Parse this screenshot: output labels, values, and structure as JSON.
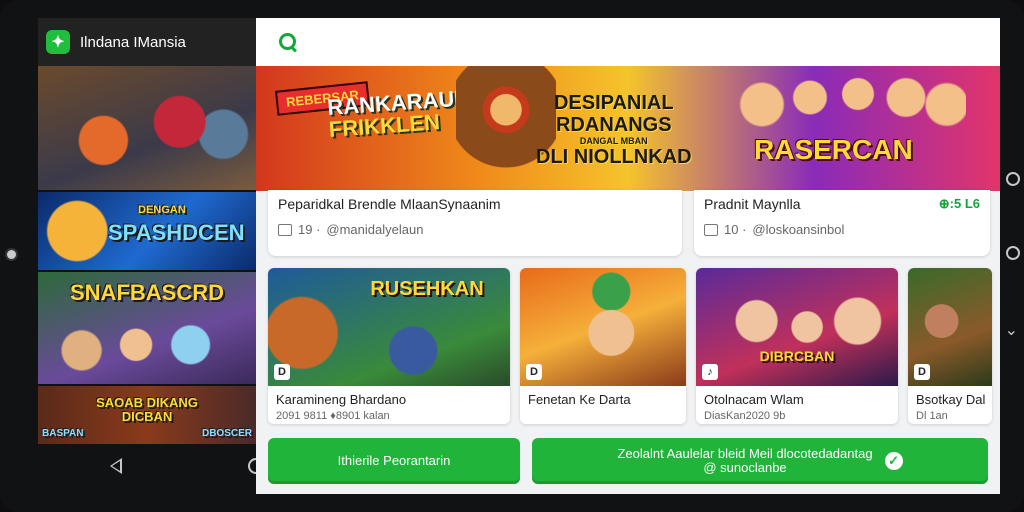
{
  "app": {
    "name": "Ilndana IMansia",
    "logo_icon": "puzzle-icon"
  },
  "colors": {
    "accent": "#21b43a",
    "banner_gradient": [
      "#d2371d",
      "#f5c42b",
      "#8a2bb8"
    ]
  },
  "sidebar": {
    "thumbnails": [
      {
        "label": ""
      },
      {
        "label": "SPASHDCEN",
        "sub": "DENGAN"
      },
      {
        "label": "SNAFBASCRD"
      },
      {
        "label": "SAOAB DIKANG DICBAN",
        "corner_left": "BASPAN",
        "corner_right": "DBOSCER"
      }
    ]
  },
  "banner": {
    "tag": "REBERSAR",
    "title1_line1": "RANKARAUN",
    "title1_line2": "FRIKKLEN",
    "title2_line1": "DESIPANIAL",
    "title2_line2": "RDANANGS",
    "title2_small": "DANGAL MBAN",
    "title2_line3": "DLI NIOLLNKAD",
    "title3": "RASERCAN"
  },
  "cards": [
    {
      "title": "Peparidkal Brendle MlaanSynaanim",
      "comments": "19 ·",
      "handle": "@manidalyelaun"
    },
    {
      "title": "Pradnit Maynlla",
      "comments": "10 ·",
      "handle": "@loskoansinbol",
      "badge": "⊕:5 L6"
    }
  ],
  "games": [
    {
      "banner": "RUSEHKAN",
      "badge": "D",
      "name": "Karamineng Bhardano",
      "sub": "2091 9811 ♦8901 kalan"
    },
    {
      "banner": "",
      "badge": "D",
      "name": "Fenetan Ke Darta",
      "sub": ""
    },
    {
      "banner": "DIBRCBAN",
      "badge": "♪",
      "name": "Otolnacam Wlam",
      "sub": "DiasKan2020 9b"
    },
    {
      "banner": "",
      "badge": "D",
      "name": "Bsotkay Dal",
      "sub": "Dl 1an"
    }
  ],
  "buttons": {
    "primary": "Ithierile Peorantarin",
    "secondary_line1": "Zeolalnt Aaulelar bleid Meil dlocotedadantag",
    "secondary_line2": "@ sunoclanbe"
  }
}
